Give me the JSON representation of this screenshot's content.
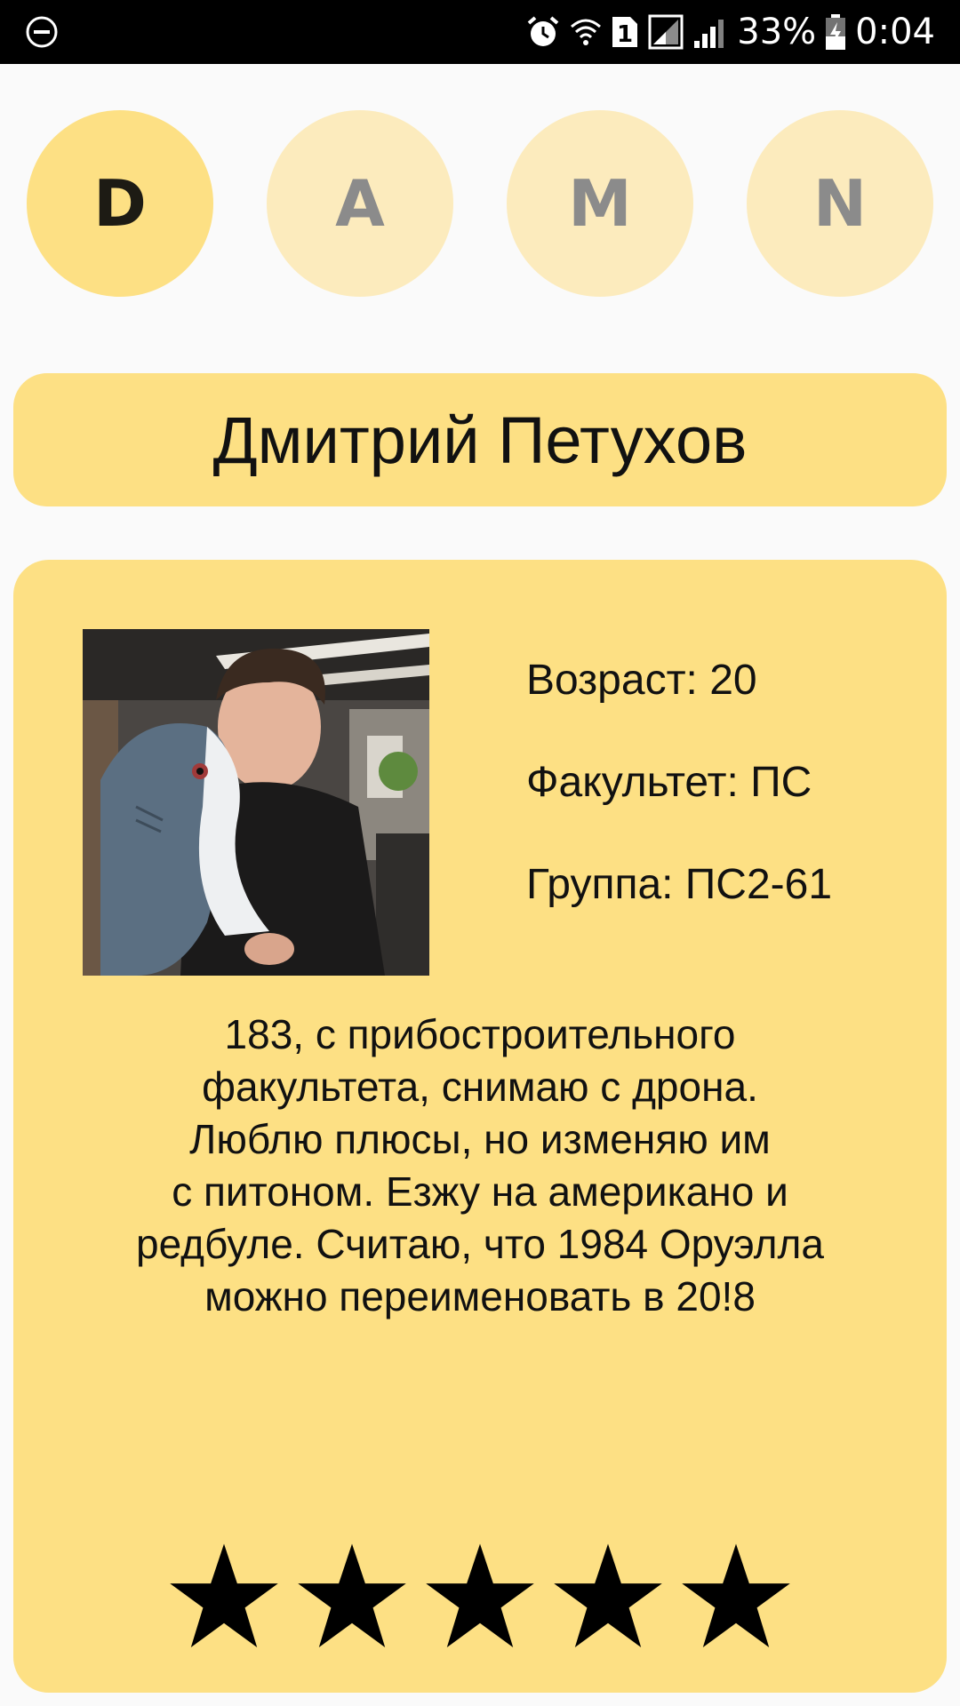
{
  "status_bar": {
    "battery": "33%",
    "time": "0:04",
    "sim_slot": "1",
    "icons": [
      "do-not-disturb-icon",
      "alarm-icon",
      "wifi-icon",
      "sim-1-icon",
      "signal-icon",
      "signal-icon",
      "battery-charging-icon"
    ]
  },
  "team_tabs": [
    {
      "letter": "D",
      "active": true
    },
    {
      "letter": "A",
      "active": false
    },
    {
      "letter": "M",
      "active": false
    },
    {
      "letter": "N",
      "active": false
    }
  ],
  "profile": {
    "name": "Дмитрий Петухов",
    "age_line": "Возраст: 20",
    "faculty_line": "Факультет: ПС",
    "group_line": "Группа: ПС2-61",
    "bio_lines": [
      "183, с прибостроительного",
      "факультета, снимаю с дрона.",
      "Люблю плюсы, но изменяю им",
      "с питоном. Езжу на американо и",
      "редбуле. Считаю, что 1984 Оруэлла",
      "можно переименовать в 20!8"
    ],
    "photo_icon": "person-with-plush-shark-photo"
  },
  "rating": {
    "value": 5,
    "max": 5,
    "star_icon": "star-icon"
  },
  "colors": {
    "accent": "#fde084",
    "accent_light": "#fcebbd",
    "background": "#fafafa",
    "status_bar": "#000000"
  }
}
